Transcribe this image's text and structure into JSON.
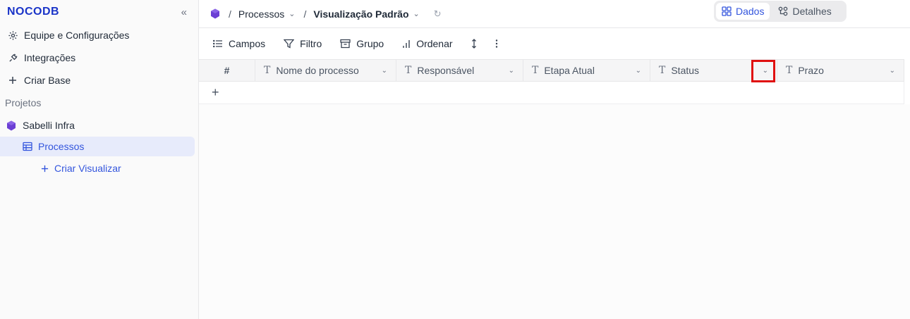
{
  "app": {
    "logo": "NOCODB",
    "collapse_icon": "«"
  },
  "sidebar": {
    "items": [
      {
        "label": "Equipe e Configurações",
        "icon": "gear-icon"
      },
      {
        "label": "Integrações",
        "icon": "plug-icon"
      },
      {
        "label": "Criar Base",
        "icon": "plus-icon"
      }
    ],
    "section_label": "Projetos",
    "project": {
      "label": "Sabelli Infra",
      "icon": "base-cube-icon",
      "color": "#6b3fd4"
    },
    "table": {
      "label": "Processos",
      "icon": "table-icon"
    },
    "create_view": {
      "label": "Criar Visualizar",
      "icon": "plus-icon"
    }
  },
  "topbar": {
    "crumb_separator_1": "/",
    "crumb_table": "Processos",
    "crumb_separator_2": "/",
    "crumb_view": "Visualização Padrão",
    "tabs": [
      {
        "label": "Dados",
        "icon": "grid-icon",
        "active": true
      },
      {
        "label": "Detalhes",
        "icon": "details-icon",
        "active": false
      }
    ]
  },
  "toolbar": {
    "fields": "Campos",
    "filter": "Filtro",
    "group": "Grupo",
    "sort": "Ordenar"
  },
  "grid": {
    "row_number_header": "#",
    "columns": [
      {
        "name": "Nome do processo",
        "type_icon": "T"
      },
      {
        "name": "Responsável",
        "type_icon": "T"
      },
      {
        "name": "Etapa Atual",
        "type_icon": "T"
      },
      {
        "name": "Status",
        "type_icon": "T"
      },
      {
        "name": "Prazo",
        "type_icon": "T"
      }
    ],
    "add_row": "+"
  },
  "accent_color": "#3355dd",
  "highlight_color": "#e01010"
}
